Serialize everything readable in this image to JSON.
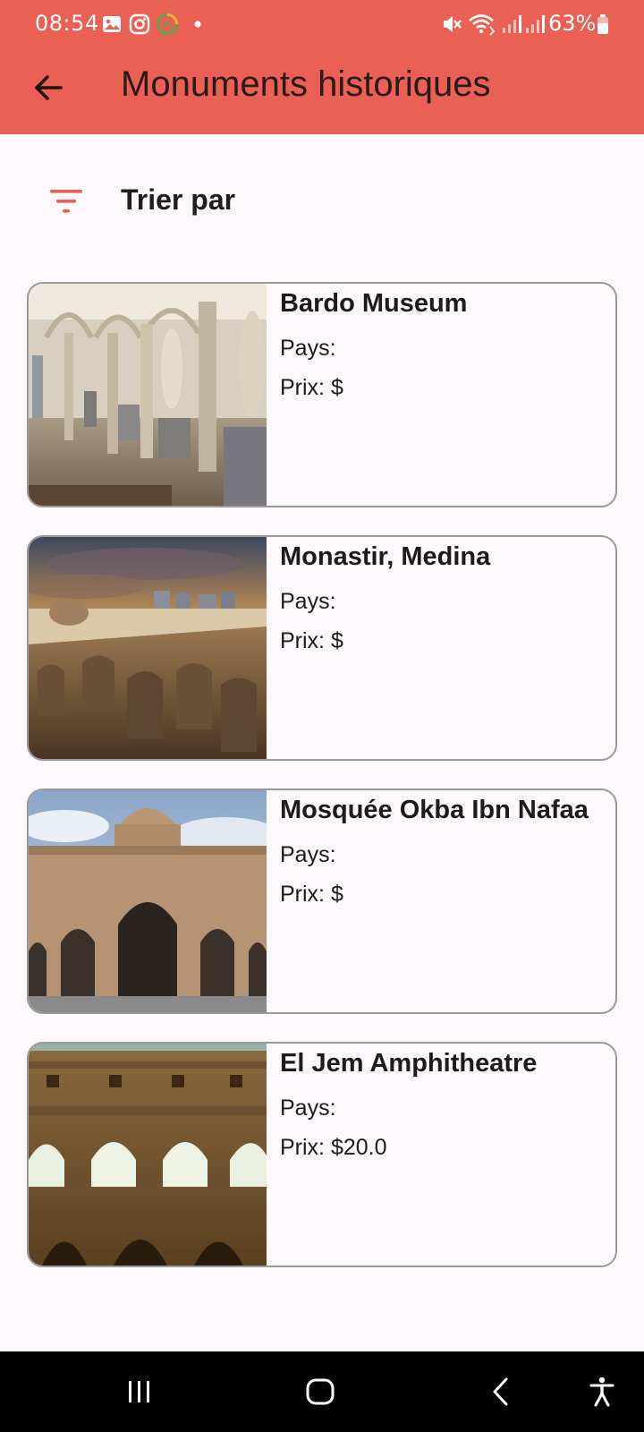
{
  "status_bar": {
    "time": "08:54",
    "battery": "63%",
    "icons": [
      "gallery-icon",
      "instagram-icon",
      "app-badge-icon",
      "dot-icon",
      "mute-icon",
      "wifi-icon",
      "signal-icon",
      "signal-icon",
      "battery-icon"
    ]
  },
  "app_bar": {
    "title": "Monuments historiques",
    "back_icon": "arrow-left-icon"
  },
  "sort": {
    "label": "Trier par",
    "icon": "filter-icon",
    "accent": "#ea6054"
  },
  "monuments": [
    {
      "title": "Bardo Museum",
      "country": "Pays:",
      "price": "Prix: $",
      "image": "museum-hall"
    },
    {
      "title": "Monastir, Medina",
      "country": "Pays:",
      "price": "Prix: $",
      "image": "medina-sunset"
    },
    {
      "title": "Mosquée Okba Ibn Nafaa",
      "country": "Pays:",
      "price": "Prix: $",
      "image": "mosque-facade"
    },
    {
      "title": "El Jem Amphitheatre",
      "country": "Pays:",
      "price": "Prix: $20.0",
      "image": "amphitheatre-arches"
    }
  ],
  "nav_bar": {
    "icons": [
      "recents-icon",
      "home-icon",
      "back-icon",
      "accessibility-icon"
    ]
  },
  "colors": {
    "header": "#ea6054",
    "background": "#fdf8fc",
    "card_border": "#9a9a9a",
    "nav": "#000000"
  }
}
